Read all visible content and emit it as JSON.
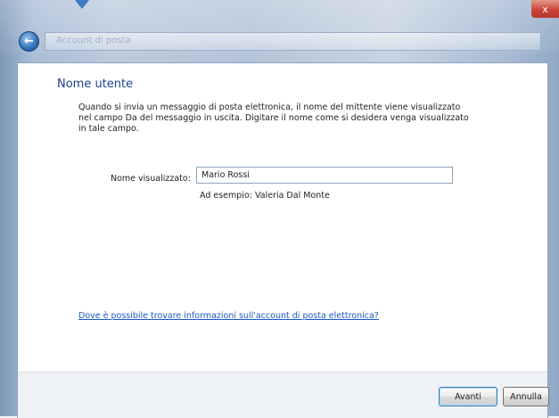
{
  "window": {
    "close_glyph": "x",
    "address_text": "Account di posta",
    "back_glyph": "←"
  },
  "page": {
    "heading": "Nome utente",
    "description": "Quando si invia un messaggio di posta elettronica, il nome del mittente viene visualizzato\nnel campo Da del messaggio in uscita. Digitare il nome come si desidera venga visualizzato\nin tale campo.",
    "display_name_label": "Nome visualizzato:",
    "display_name_value": "Mario Rossi",
    "example_text": "Ad esempio: Valeria Dal Monte",
    "help_link": "Dove è possibile trovare informazioni sull'account di posta elettronica?"
  },
  "buttons": {
    "next_label": "Avanti",
    "cancel_label": "Annulla"
  },
  "colors": {
    "heading": "#1e3d8f",
    "link": "#1a57c7",
    "close": "#c9453a"
  }
}
